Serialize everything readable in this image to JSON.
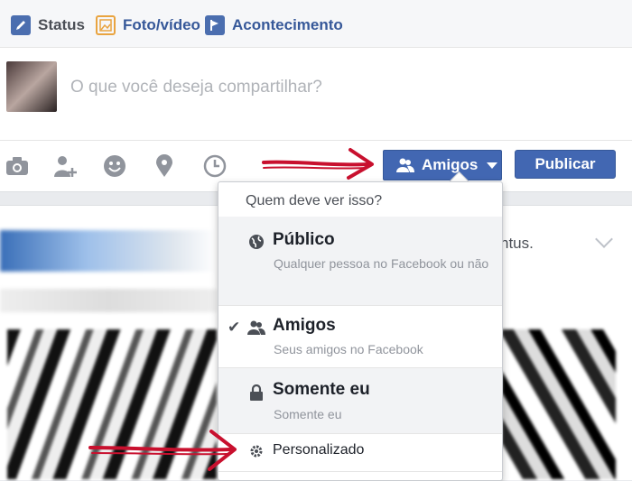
{
  "tabs": [
    {
      "label": "Status",
      "icon": "pencil-icon"
    },
    {
      "label": "Foto/vídeo",
      "icon": "photo-icon"
    },
    {
      "label": "Acontecimento",
      "icon": "flag-icon"
    }
  ],
  "composer": {
    "placeholder": "O que você deseja compartilhar?"
  },
  "actions": [
    "camera-icon",
    "tag-friends-icon",
    "feeling-icon",
    "location-icon",
    "clock-icon"
  ],
  "audience_button": {
    "label": "Amigos",
    "icon": "friends-icon"
  },
  "publish_button": {
    "label": "Publicar"
  },
  "post": {
    "fragment_text": "ntus."
  },
  "dropdown": {
    "header": "Quem deve ver isso?",
    "options": [
      {
        "title": "Público",
        "subtitle": "Qualquer pessoa no Facebook ou não",
        "icon": "globe-icon",
        "selected": false
      },
      {
        "title": "Amigos",
        "subtitle": "Seus amigos no Facebook",
        "icon": "friends-icon",
        "selected": true
      },
      {
        "title": "Somente eu",
        "subtitle": "Somente eu",
        "icon": "lock-icon",
        "selected": false
      },
      {
        "title": "Personalizado",
        "icon": "gear-icon",
        "selected": false
      }
    ]
  },
  "colors": {
    "brand": "#4267b2",
    "link": "#365899",
    "annotation_arrow": "#c8102e"
  }
}
